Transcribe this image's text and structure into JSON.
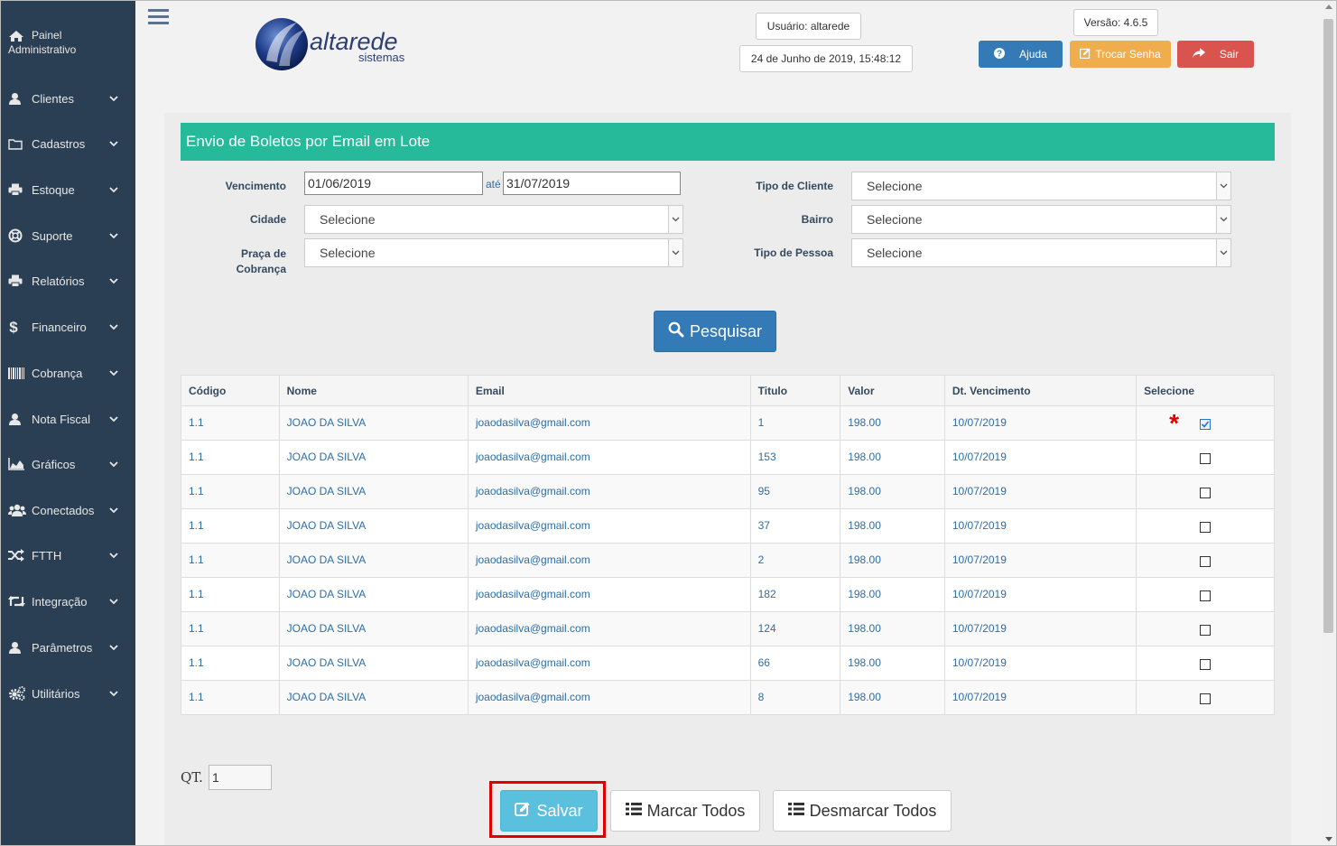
{
  "sidebar": {
    "home_line1": "Painel",
    "home_line2": "Administrativo",
    "items": [
      {
        "label": "Clientes",
        "icon": "user-icon"
      },
      {
        "label": "Cadastros",
        "icon": "folder-icon"
      },
      {
        "label": "Estoque",
        "icon": "printer-icon"
      },
      {
        "label": "Suporte",
        "icon": "lifebuoy-icon"
      },
      {
        "label": "Relatórios",
        "icon": "printer-icon"
      },
      {
        "label": "Financeiro",
        "icon": "dollar-icon"
      },
      {
        "label": "Cobrança",
        "icon": "barcode-icon"
      },
      {
        "label": "Nota Fiscal",
        "icon": "user-icon"
      },
      {
        "label": "Gráficos",
        "icon": "area-chart-icon"
      },
      {
        "label": "Conectados",
        "icon": "users-icon"
      },
      {
        "label": "FTTH",
        "icon": "random-icon"
      },
      {
        "label": "Integração",
        "icon": "retweet-icon"
      },
      {
        "label": "Parâmetros",
        "icon": "user-icon"
      },
      {
        "label": "Utilitários",
        "icon": "cogs-icon"
      }
    ]
  },
  "header": {
    "logo_main": "altarede",
    "logo_sub": "sistemas",
    "user": "Usuário: altarede",
    "datetime": "24 de Junho de 2019, 15:48:12",
    "version": "Versão: 4.6.5",
    "help": "Ajuda",
    "change_password": "Trocar Senha",
    "exit": "Sair",
    "colors": {
      "help": "#337ab7",
      "change_password": "#f0ad4e",
      "exit": "#d9534f"
    }
  },
  "panel": {
    "title": "Envio de Boletos por Email em Lote",
    "accent": "#26b99a",
    "filters": {
      "vencimento_label": "Vencimento",
      "date_from": "01/06/2019",
      "ate": "até",
      "date_to": "31/07/2019",
      "cidade_label": "Cidade",
      "cidade_value": "Selecione",
      "praca_label_1": "Praça de",
      "praca_label_2": "Cobrança",
      "praca_value": "Selecione",
      "tipo_cliente_label": "Tipo de Cliente",
      "tipo_cliente_value": "Selecione",
      "bairro_label": "Bairro",
      "bairro_value": "Selecione",
      "tipo_pessoa_label": "Tipo de Pessoa",
      "tipo_pessoa_value": "Selecione"
    },
    "search_button": "Pesquisar"
  },
  "table": {
    "headers": [
      "Código",
      "Nome",
      "Email",
      "Titulo",
      "Valor",
      "Dt. Vencimento",
      "Selecione"
    ],
    "rows": [
      {
        "codigo": "1.1",
        "nome": "JOAO DA SILVA",
        "email": "joaodasilva@gmail.com",
        "titulo": "1",
        "valor": "198.00",
        "vencimento": "10/07/2019",
        "checked": true
      },
      {
        "codigo": "1.1",
        "nome": "JOAO DA SILVA",
        "email": "joaodasilva@gmail.com",
        "titulo": "153",
        "valor": "198.00",
        "vencimento": "10/07/2019",
        "checked": false
      },
      {
        "codigo": "1.1",
        "nome": "JOAO DA SILVA",
        "email": "joaodasilva@gmail.com",
        "titulo": "95",
        "valor": "198.00",
        "vencimento": "10/07/2019",
        "checked": false
      },
      {
        "codigo": "1.1",
        "nome": "JOAO DA SILVA",
        "email": "joaodasilva@gmail.com",
        "titulo": "37",
        "valor": "198.00",
        "vencimento": "10/07/2019",
        "checked": false
      },
      {
        "codigo": "1.1",
        "nome": "JOAO DA SILVA",
        "email": "joaodasilva@gmail.com",
        "titulo": "2",
        "valor": "198.00",
        "vencimento": "10/07/2019",
        "checked": false
      },
      {
        "codigo": "1.1",
        "nome": "JOAO DA SILVA",
        "email": "joaodasilva@gmail.com",
        "titulo": "182",
        "valor": "198.00",
        "vencimento": "10/07/2019",
        "checked": false
      },
      {
        "codigo": "1.1",
        "nome": "JOAO DA SILVA",
        "email": "joaodasilva@gmail.com",
        "titulo": "124",
        "valor": "198.00",
        "vencimento": "10/07/2019",
        "checked": false
      },
      {
        "codigo": "1.1",
        "nome": "JOAO DA SILVA",
        "email": "joaodasilva@gmail.com",
        "titulo": "66",
        "valor": "198.00",
        "vencimento": "10/07/2019",
        "checked": false
      },
      {
        "codigo": "1.1",
        "nome": "JOAO DA SILVA",
        "email": "joaodasilva@gmail.com",
        "titulo": "8",
        "valor": "198.00",
        "vencimento": "10/07/2019",
        "checked": false
      }
    ]
  },
  "footer": {
    "qt_label": "QT.",
    "qt_value": "1",
    "save": "Salvar",
    "mark_all": "Marcar Todos",
    "unmark_all": "Desmarcar Todos",
    "highlight_color": "#e00000"
  }
}
